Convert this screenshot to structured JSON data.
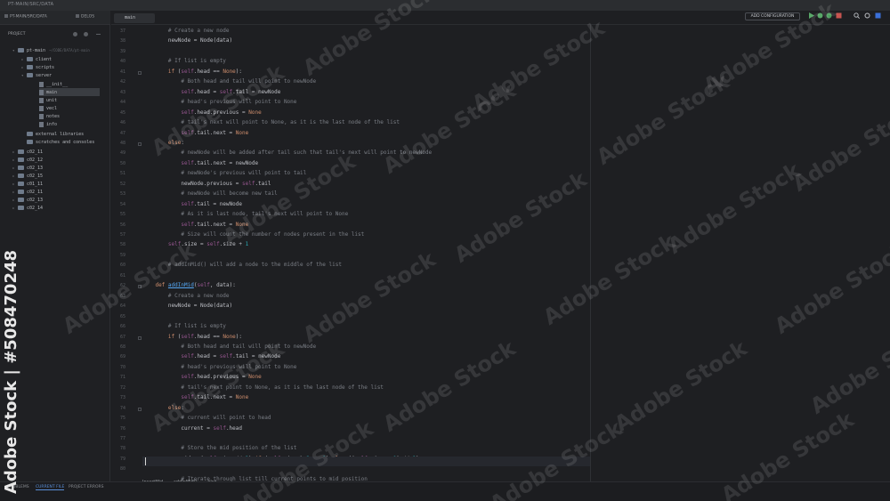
{
  "window": {
    "title": "PT-MAIN/SRC/DATA"
  },
  "left_panel": {
    "tabs": [
      "PT-MAIN/SRC/DATA",
      "DELOS"
    ],
    "project_label": "PROJECT",
    "root": "pt-main",
    "root_path": "~/CODE/DATA/pt-main",
    "tree": [
      "client",
      "scripts",
      "server",
      "__init__",
      "main",
      "unit",
      "vecl",
      "notes",
      "info",
      "external libraries",
      "scratches and consoles",
      "c02_11",
      "c02_12",
      "c02_13",
      "c02_15",
      "c01_11",
      "c02_11",
      "c02_13",
      "c02_14"
    ],
    "bottom": {
      "terminal": "TERMINAL",
      "console": "CONSOLE"
    }
  },
  "editor": {
    "tab": "main",
    "toolbar": {
      "add_configuration": "ADD CONFIGURATION"
    },
    "inspections": {
      "warnings": "49",
      "weak": "66"
    },
    "line_numbers": [
      "37",
      "38",
      "39",
      "40",
      "41",
      "42",
      "43",
      "44",
      "45",
      "46",
      "47",
      "48",
      "49",
      "50",
      "51",
      "52",
      "53",
      "54",
      "55",
      "56",
      "57",
      "58",
      "59",
      "60",
      "61",
      "62",
      "63",
      "64",
      "65",
      "66",
      "67",
      "68",
      "69",
      "70",
      "71",
      "72",
      "73",
      "74",
      "75",
      "76",
      "77",
      "78",
      "79",
      "80"
    ],
    "code_lines": [
      "        # Create a new node",
      "        newNode = Node(data)",
      "",
      "        # If list is empty",
      "        if (self.head == None):",
      "            # Both head and tail will point to newNode",
      "            self.head = self.tail = newNode",
      "            # head's previous will point to None",
      "            self.head.previous = None",
      "            # tail's next will point to None, as it is the last node of the list",
      "            self.tail.next = None",
      "        else:",
      "            # newNode will be added after tail such that tail's next will point to newNode",
      "            self.tail.next = newNode",
      "            # newNode's previous will point to tail",
      "            newNode.previous = self.tail",
      "            # newNode will become new tail",
      "            self.tail = newNode",
      "            # As it is last node, tail's next will point to None",
      "            self.tail.next = None",
      "            # Size will count the number of nodes present in the list",
      "        self.size = self.size + 1",
      "",
      "        # addInMid() will add a node to the middle of the list",
      "",
      "    def addInMid(self, data):",
      "        # Create a new node",
      "        newNode = Node(data)",
      "",
      "        # If list is empty",
      "        if (self.head == None):",
      "            # Both head and tail will point to newNode",
      "            self.head = self.tail = newNode",
      "            # head's previous will point to None",
      "            self.head.previous = None",
      "            # tail's next point to None, as it is the last node of the list",
      "            self.tail.next = None",
      "        else:",
      "            # current will point to head",
      "            current = self.head",
      "",
      "            # Store the mid position of the list",
      "            mid = (self.size // 2) if (self.size % 2 == 0) else ((self.size + 1) // 2)",
      "",
      "            # Iterate through list till current points to mid position"
    ],
    "breadcrumbs": [
      "InsertMid",
      "addInMid()",
      "else"
    ]
  },
  "statusbar": [
    "PROBLEMS",
    "CURRENT FILE",
    "PROJECT ERRORS"
  ],
  "watermark": {
    "text": "Adobe Stock",
    "id": "Adobe Stock | #508470248"
  },
  "colors": {
    "bg": "#1e1f22",
    "keyword": "#cf8e6d",
    "self": "#94558d",
    "comment": "#7a7e85",
    "func": "#56a8f5"
  }
}
